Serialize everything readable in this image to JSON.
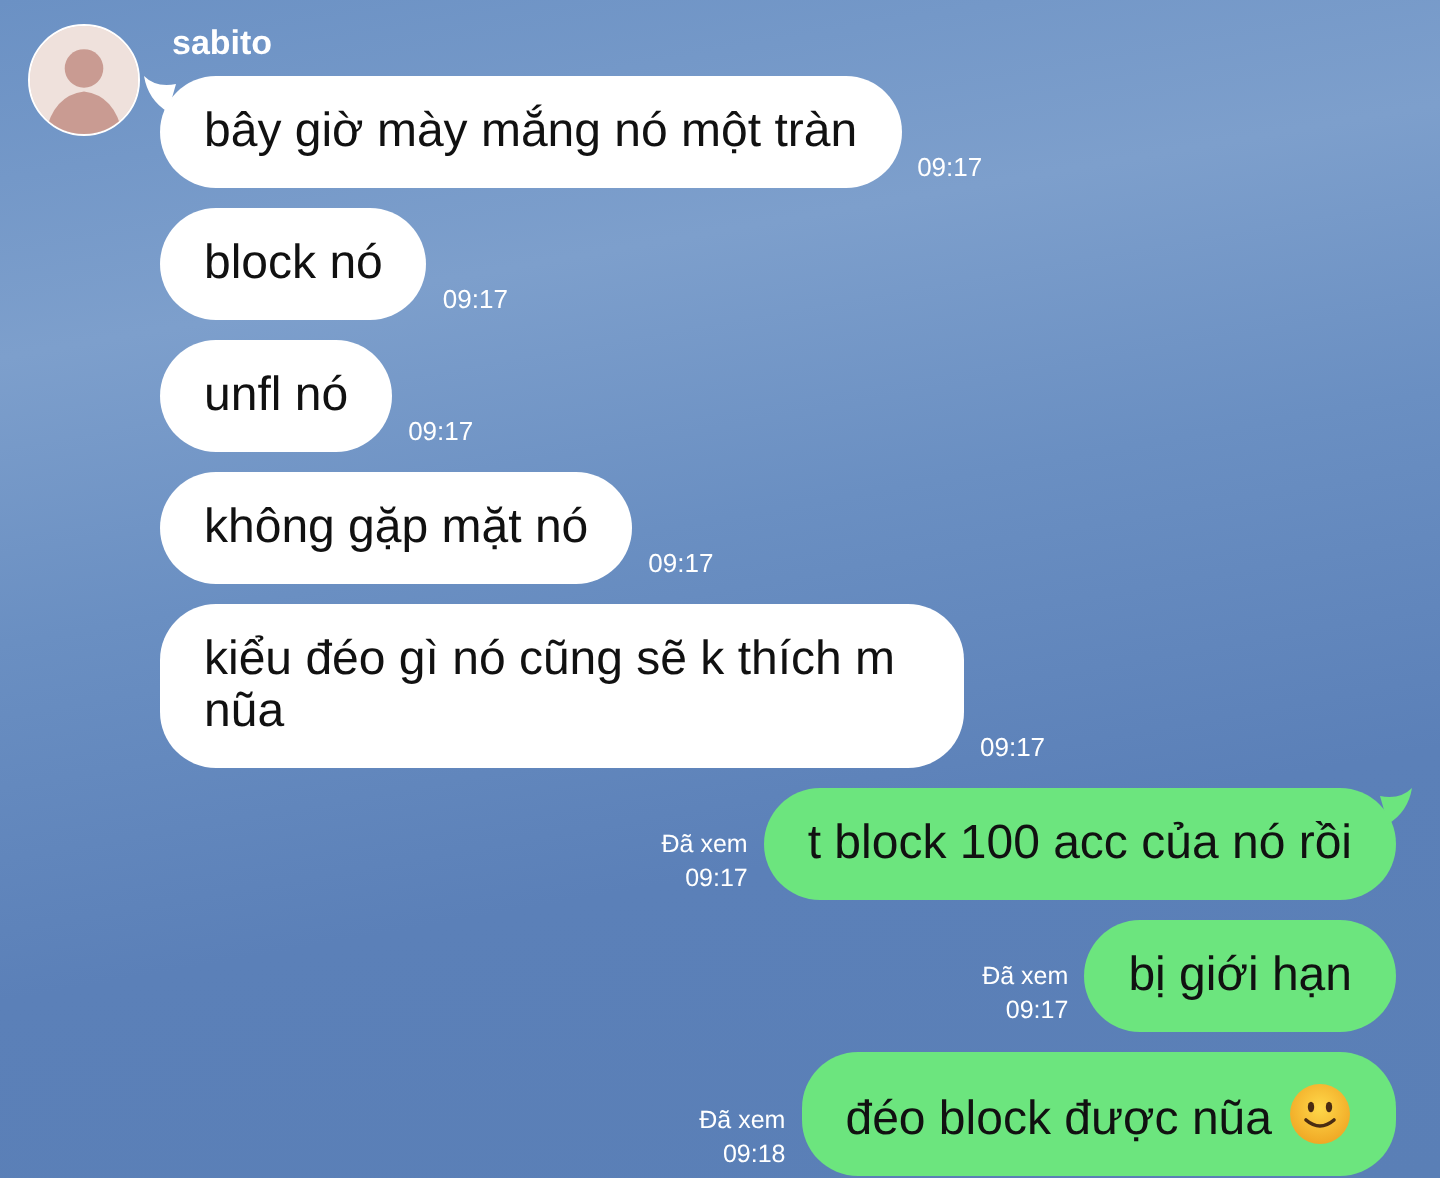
{
  "sender": {
    "name": "sabito"
  },
  "messages": [
    {
      "kind": "incoming",
      "text": "bây giờ mày mắng nó một tràn",
      "time": "09:17",
      "tail": true
    },
    {
      "kind": "incoming",
      "text": "block nó",
      "time": "09:17",
      "tail": false
    },
    {
      "kind": "incoming",
      "text": "unfl nó",
      "time": "09:17",
      "tail": false
    },
    {
      "kind": "incoming",
      "text": "không gặp mặt nó",
      "time": "09:17",
      "tail": false
    },
    {
      "kind": "incoming",
      "text": "kiểu đéo gì nó cũng sẽ k thích m nũa",
      "time": "09:17",
      "tail": false
    },
    {
      "kind": "outgoing",
      "text": "t block 100 acc của nó rồi",
      "read": "Đã xem",
      "time": "09:17",
      "tail": true
    },
    {
      "kind": "outgoing",
      "text": "bị giới hạn",
      "read": "Đã xem",
      "time": "09:17",
      "tail": false
    },
    {
      "kind": "outgoing",
      "text": "đéo block được nũa",
      "read": "Đã xem",
      "time": "09:18",
      "tail": false,
      "smiley": true
    }
  ]
}
